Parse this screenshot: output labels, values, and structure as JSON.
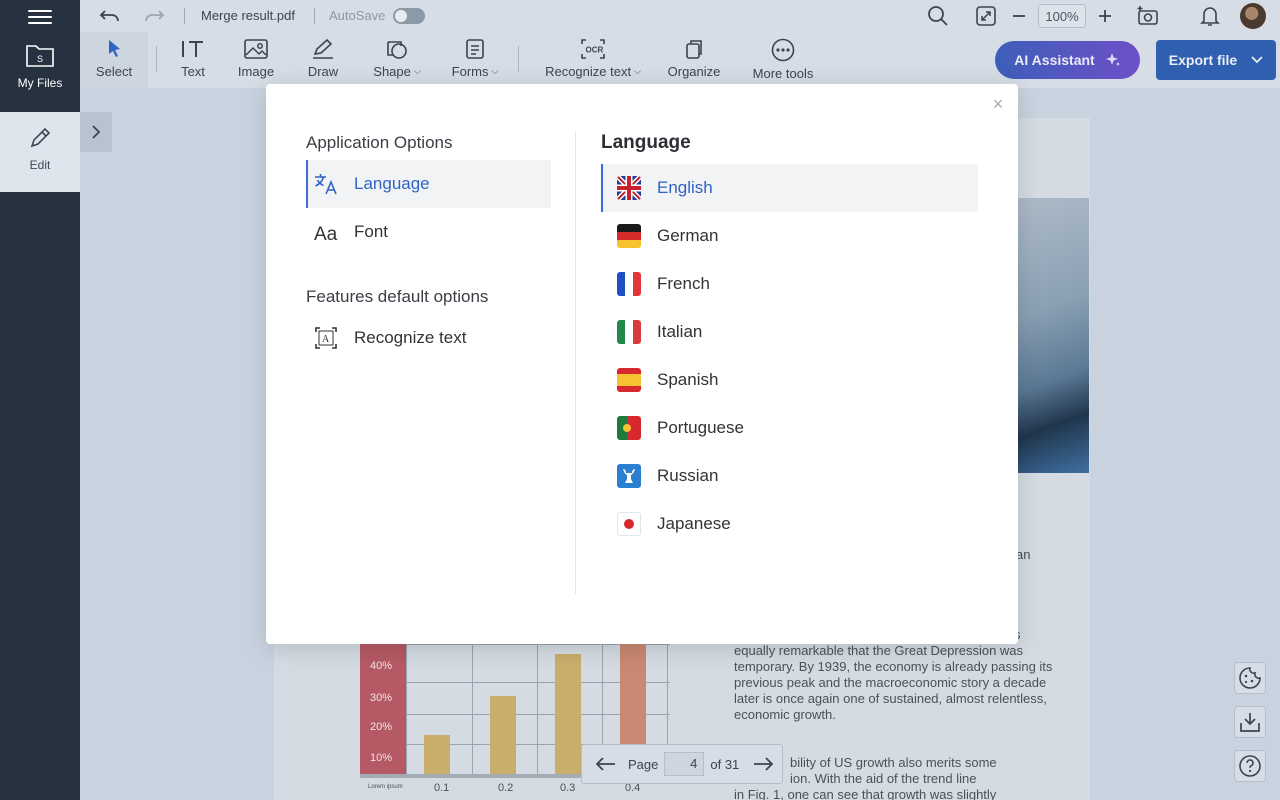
{
  "rail": {
    "files_label": "My Files",
    "edit_label": "Edit"
  },
  "topbar": {
    "file_name": "Merge result.pdf",
    "autosave_label": "AutoSave",
    "zoom_value": "100%"
  },
  "toolbar": {
    "tools": {
      "select": "Select",
      "text": "Text",
      "image": "Image",
      "draw": "Draw",
      "shape": "Shape",
      "forms": "Forms",
      "recognize": "Recognize text",
      "organize": "Organize",
      "more": "More tools"
    },
    "ai_label": "AI Assistant",
    "export_label": "Export file"
  },
  "document": {
    "text_fragment_1": "an",
    "text_fragment_2": "s",
    "paragraph_1": "equally remarkable that the Great Depression was temporary. By 1939, the economy is already passing its previous peak and the macroeconomic story a decade later is once again one of sustained, almost relentless, economic growth.",
    "paragraph_2_line_1": "bility of US growth also merits some",
    "paragraph_2_line_2": "ion. With the aid of the trend line",
    "paragraph_2_line_3": "in Fig. 1, one can see that growth was slightly",
    "chart_x_small_label": "Lorem ipsum"
  },
  "chart_data": {
    "type": "bar",
    "categories": [
      "0.1",
      "0.2",
      "0.3",
      "0.4"
    ],
    "values": [
      15,
      30,
      46,
      50
    ],
    "y_ticks": [
      "40%",
      "30%",
      "20%",
      "10%"
    ],
    "bar_colors": [
      "#c9ae6b",
      "#c9ae6b",
      "#c9ae6b",
      "#c98871"
    ]
  },
  "pager": {
    "page_label": "Page",
    "current_page": "4",
    "of_label": "of 31"
  },
  "modal": {
    "close_glyph": "×",
    "application_options_title": "Application Options",
    "options": [
      {
        "label": "Language"
      },
      {
        "label": "Font"
      }
    ],
    "features_title": "Features default options",
    "feature_options": [
      {
        "label": "Recognize text"
      }
    ],
    "language_title": "Language",
    "languages": [
      {
        "label": "English"
      },
      {
        "label": "German"
      },
      {
        "label": "French"
      },
      {
        "label": "Italian"
      },
      {
        "label": "Spanish"
      },
      {
        "label": "Portuguese"
      },
      {
        "label": "Russian"
      },
      {
        "label": "Japanese"
      }
    ],
    "selected_language": "English"
  },
  "colors": {
    "accent": "#3b6ed1",
    "rail_bg": "#26323f",
    "export_bg": "#2f5fae"
  },
  "icons": [
    "hamburger-icon",
    "folder-icon",
    "pencil-icon",
    "undo-icon",
    "redo-icon",
    "search-icon",
    "fit-page-icon",
    "zoom-out-icon",
    "zoom-in-icon",
    "camera-add-icon",
    "bell-icon",
    "cursor-icon",
    "text-tool-icon",
    "image-icon",
    "draw-icon",
    "shape-icon",
    "forms-icon",
    "ocr-icon",
    "organize-icon",
    "more-icon",
    "sparkle-icon",
    "chevron-down-icon",
    "chevron-right-icon",
    "arrow-left-icon",
    "arrow-right-icon",
    "cookie-icon",
    "download-icon",
    "help-icon",
    "close-icon",
    "translate-icon",
    "font-icon",
    "recognize-text-icon"
  ]
}
